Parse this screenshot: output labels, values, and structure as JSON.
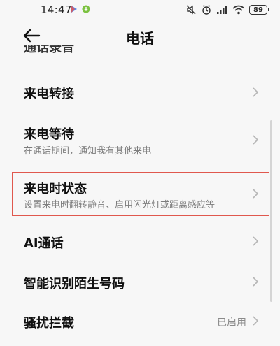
{
  "status_bar": {
    "time": "14:47",
    "battery": "89"
  },
  "header": {
    "title": "电话"
  },
  "list": {
    "partial_item": "通话录音",
    "items": [
      {
        "title": "来电转接",
        "subtitle": "",
        "status": ""
      },
      {
        "title": "来电等待",
        "subtitle": "在通话期间，通知我有其他来电",
        "status": ""
      },
      {
        "title": "来电时状态",
        "subtitle": "设置来电时翻转静音、启用闪光灯或距离感应等",
        "status": ""
      },
      {
        "title": "AI通话",
        "subtitle": "",
        "status": ""
      },
      {
        "title": "智能识别陌生号码",
        "subtitle": "",
        "status": ""
      },
      {
        "title": "骚扰拦截",
        "subtitle": "",
        "status": "已启用"
      }
    ]
  },
  "icons": {
    "back": "arrow-left-icon",
    "chevron": "chevron-right-icon"
  },
  "colors": {
    "highlight": "#e0584e",
    "background": "#f7f7f7"
  }
}
